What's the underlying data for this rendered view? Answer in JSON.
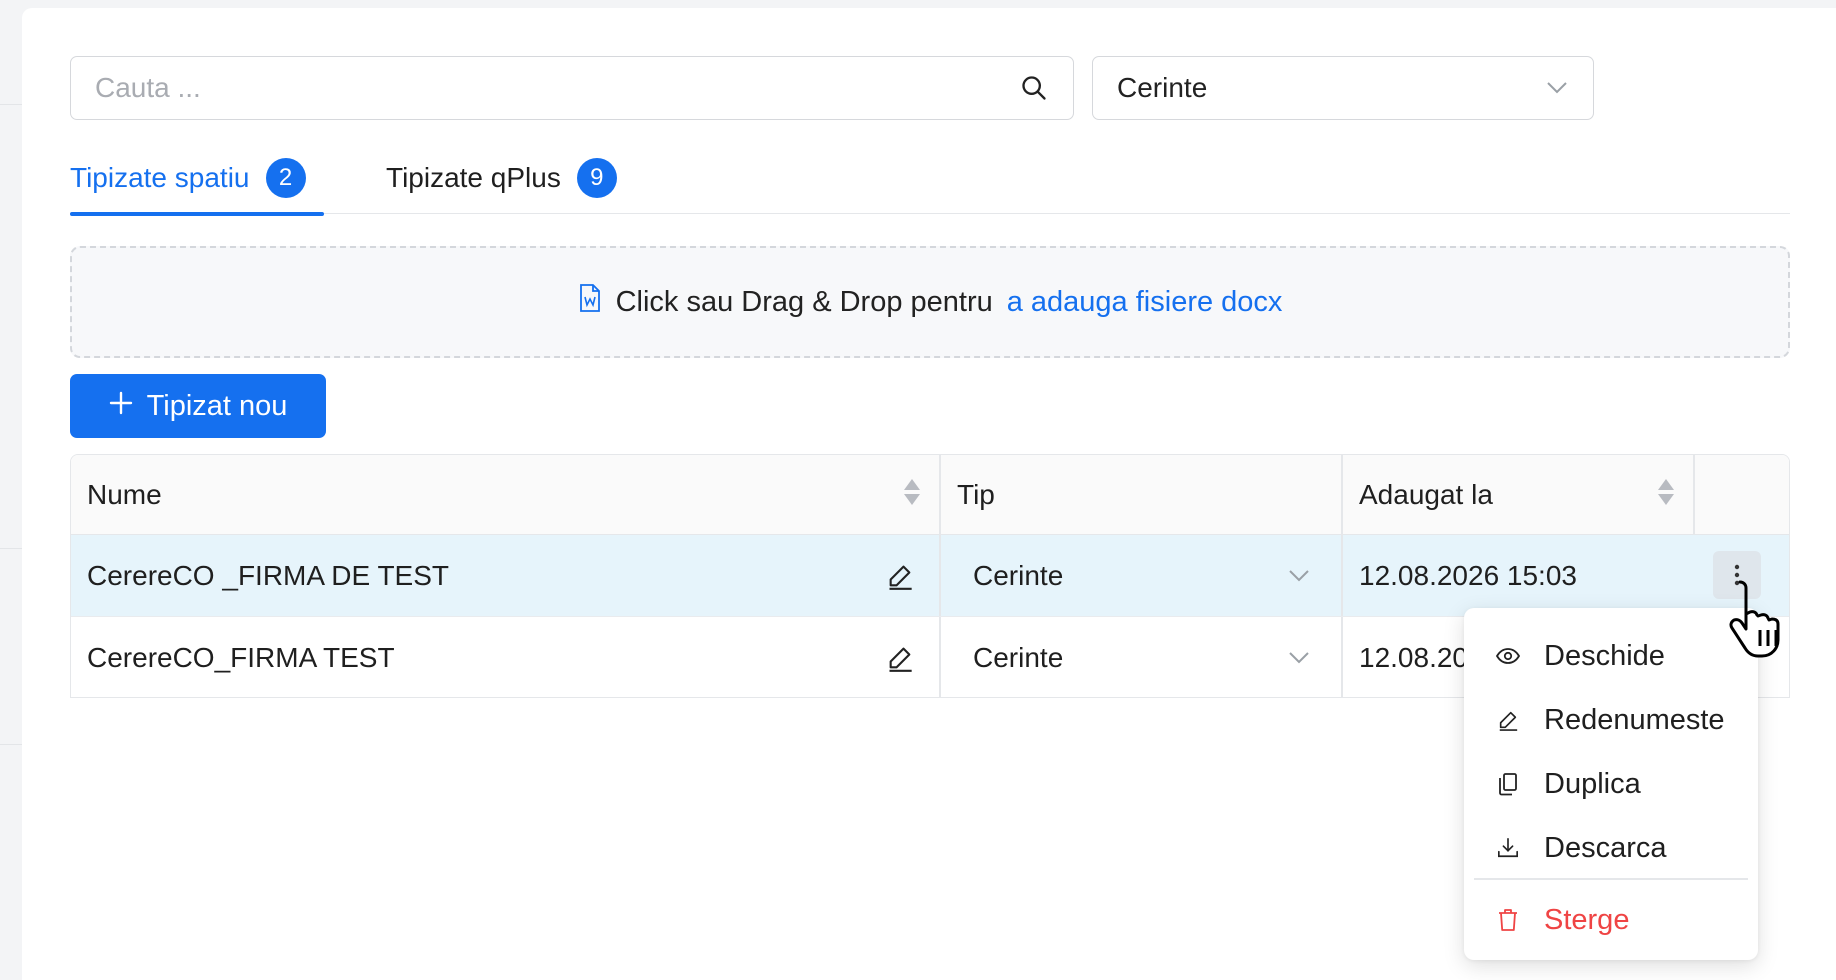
{
  "search": {
    "placeholder": "Cauta ..."
  },
  "filter": {
    "selected": "Cerinte"
  },
  "tabs": [
    {
      "label": "Tipizate spatiu",
      "count": "2",
      "active": true
    },
    {
      "label": "Tipizate qPlus",
      "count": "9",
      "active": false
    }
  ],
  "dropzone": {
    "text": "Click sau Drag & Drop pentru",
    "link": "a adauga fisiere docx",
    "icon": "word-doc-icon"
  },
  "new_button": {
    "label": "Tipizat nou",
    "icon": "plus-icon"
  },
  "table": {
    "columns": [
      "Nume",
      "Tip",
      "Adaugat la",
      ""
    ],
    "rows": [
      {
        "name": "CerereCO _FIRMA DE TEST",
        "type": "Cerinte",
        "added": "12.08.2026 15:03",
        "highlighted": true
      },
      {
        "name": "CerereCO_FIRMA TEST",
        "type": "Cerinte",
        "added": "12.08.20",
        "highlighted": false
      }
    ]
  },
  "context_menu": {
    "items": [
      {
        "label": "Deschide",
        "icon": "eye-icon"
      },
      {
        "label": "Redenumeste",
        "icon": "pencil-icon"
      },
      {
        "label": "Duplica",
        "icon": "copy-icon"
      },
      {
        "label": "Descarca",
        "icon": "download-icon"
      }
    ],
    "danger_item": {
      "label": "Sterge",
      "icon": "trash-icon"
    }
  },
  "colors": {
    "accent": "#1570ef",
    "danger": "#ef4444",
    "row_highlight": "#e6f4fb"
  }
}
